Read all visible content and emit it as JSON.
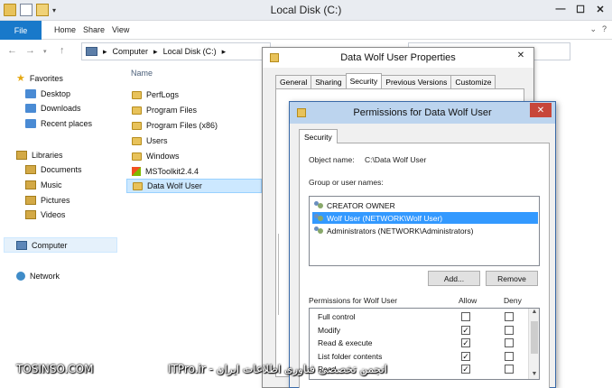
{
  "explorer": {
    "title": "Local Disk (C:)",
    "ribbon_tabs": [
      "File",
      "Home",
      "Share",
      "View"
    ],
    "address": {
      "segment_1": "Computer",
      "segment_2": "Local Disk (C:)"
    },
    "column_header": "Name",
    "sidebar": {
      "favorites": "Favorites",
      "desktop": "Desktop",
      "downloads": "Downloads",
      "recent": "Recent places",
      "libraries": "Libraries",
      "documents": "Documents",
      "music": "Music",
      "pictures": "Pictures",
      "videos": "Videos",
      "computer": "Computer",
      "network": "Network"
    },
    "files": [
      "PerfLogs",
      "Program Files",
      "Program Files (x86)",
      "Users",
      "Windows",
      "MSToolkit2.4.4",
      "Data Wolf User"
    ]
  },
  "properties": {
    "title": "Data Wolf User Properties",
    "tabs": [
      "General",
      "Sharing",
      "Security",
      "Previous Versions",
      "Customize"
    ]
  },
  "permissions": {
    "title": "Permissions for Data Wolf User",
    "tab": "Security",
    "object_label": "Object name:",
    "object_value": "C:\\Data Wolf User",
    "group_label": "Group or user names:",
    "users": [
      "CREATOR OWNER",
      "Wolf User (NETWORK\\Wolf User)",
      "Administrators (NETWORK\\Administrators)"
    ],
    "add_button": "Add...",
    "remove_button": "Remove",
    "perm_label": "Permissions for Wolf User",
    "allow_label": "Allow",
    "deny_label": "Deny",
    "perms": [
      {
        "name": "Full control",
        "allow": false,
        "deny": false
      },
      {
        "name": "Modify",
        "allow": true,
        "deny": false
      },
      {
        "name": "Read & execute",
        "allow": true,
        "deny": false
      },
      {
        "name": "List folder contents",
        "allow": true,
        "deny": false
      },
      {
        "name": "Read",
        "allow": true,
        "deny": false
      }
    ]
  },
  "watermark": {
    "left": "TOSINSO.COM",
    "center": "ITPro.ir - انجمن تخصصی فناوری اطلاعات ایران"
  }
}
